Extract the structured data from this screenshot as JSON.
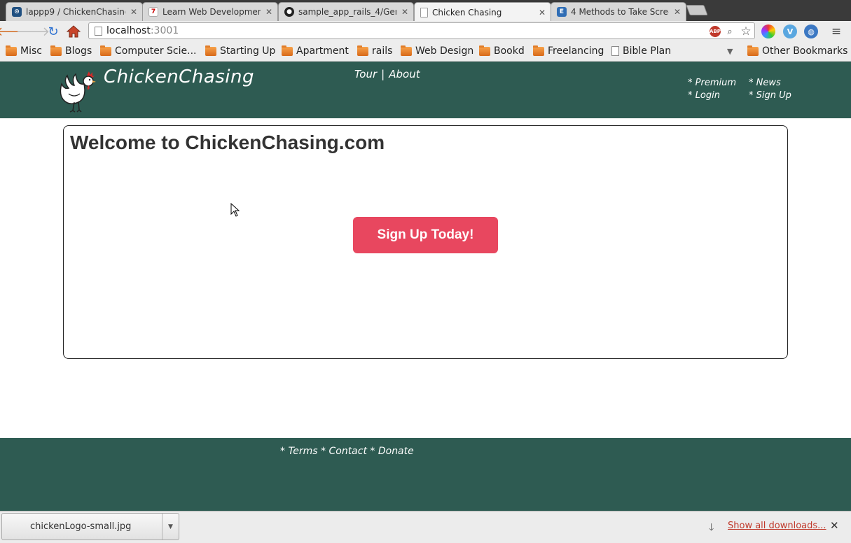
{
  "browser": {
    "tabs": [
      {
        "title": "lappp9 / ChickenChasing /",
        "icon": "bitbucket-icon",
        "active": false
      },
      {
        "title": "Learn Web Development",
        "icon": "site-favicon-icon",
        "active": false
      },
      {
        "title": "sample_app_rails_4/Gemf",
        "icon": "github-icon",
        "active": false
      },
      {
        "title": "Chicken Chasing",
        "icon": "page-icon",
        "active": true
      },
      {
        "title": "4 Methods to Take Screen",
        "icon": "site-favicon-icon",
        "active": false
      }
    ],
    "address": {
      "host": "localhost",
      "port": ":3001"
    },
    "bookmarks": [
      {
        "label": "Misc",
        "type": "folder"
      },
      {
        "label": "Blogs",
        "type": "folder"
      },
      {
        "label": "Computer Scie...",
        "type": "folder"
      },
      {
        "label": "Starting Up",
        "type": "folder"
      },
      {
        "label": "Apartment",
        "type": "folder"
      },
      {
        "label": "rails",
        "type": "folder"
      },
      {
        "label": "Web Design",
        "type": "folder"
      },
      {
        "label": "Bookd",
        "type": "folder"
      },
      {
        "label": "Freelancing",
        "type": "folder"
      },
      {
        "label": "Bible Plan",
        "type": "page"
      }
    ],
    "other_bookmarks": "Other Bookmarks"
  },
  "site": {
    "brand": "ChickenChasing",
    "top_nav": {
      "tour": "Tour",
      "separator": "|",
      "about": "About"
    },
    "right_nav": {
      "premium": "* Premium",
      "login": "* Login",
      "news": "* News",
      "signup": "* Sign Up"
    },
    "panel_title": "Welcome to ChickenChasing.com",
    "cta_label": "Sign Up Today!",
    "footer_links": "* Terms * Contact * Donate",
    "colors": {
      "header_bg": "#2e5b52",
      "cta_bg": "#e8475f"
    }
  },
  "downloads": {
    "file": "chickenLogo-small.jpg",
    "show_all": "Show all downloads..."
  }
}
